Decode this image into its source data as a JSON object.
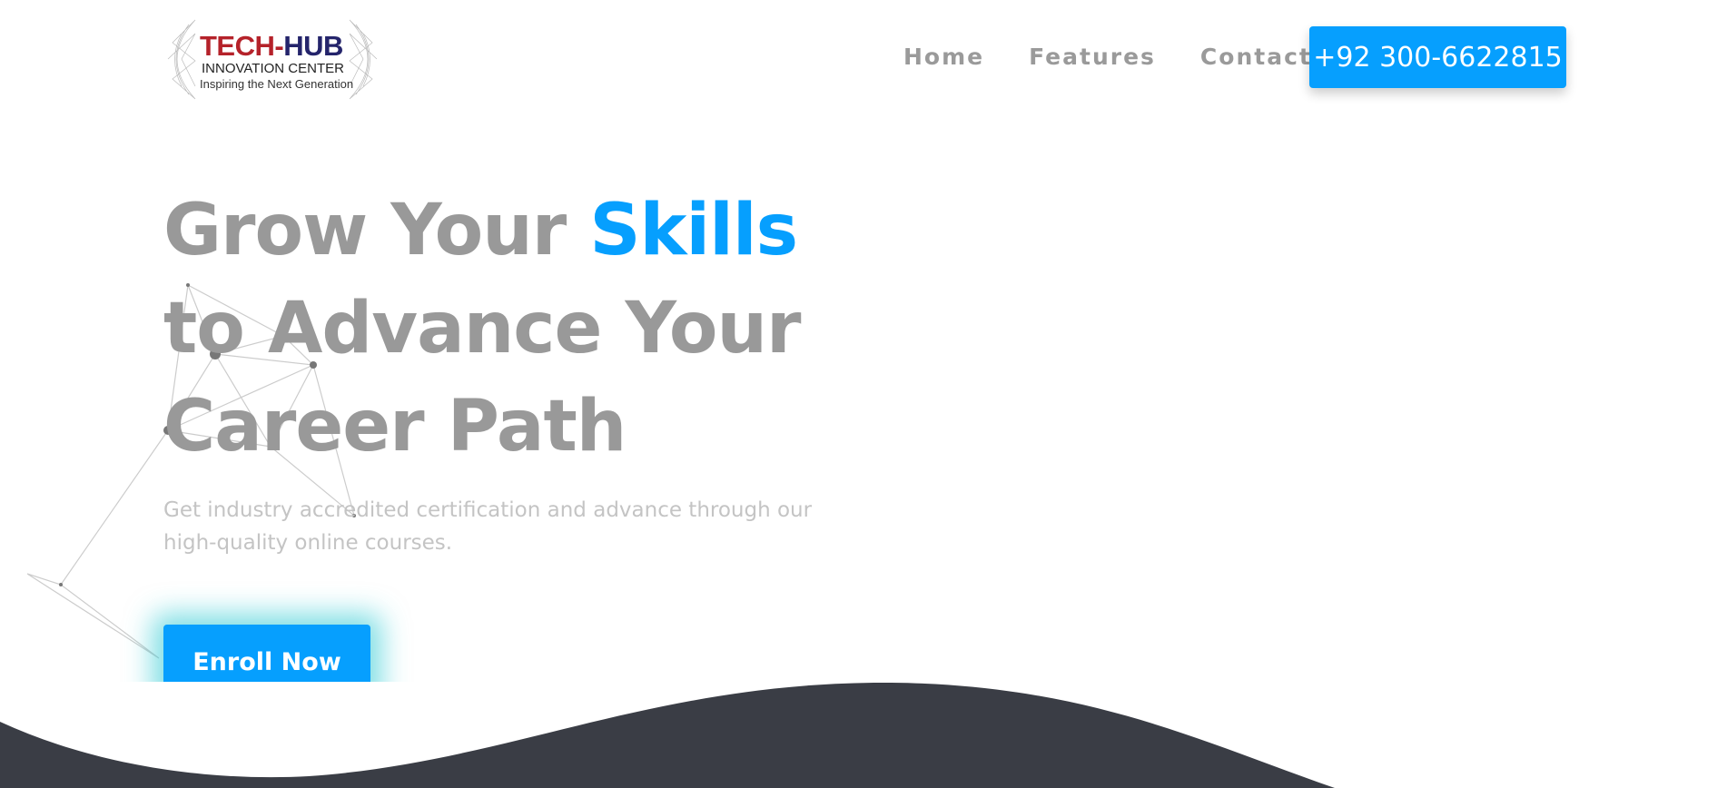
{
  "logo": {
    "brand_part1": "TECH-",
    "brand_part2": "HUB",
    "subtitle": "INNOVATION CENTER",
    "tagline": "Inspiring the Next Generation"
  },
  "nav": {
    "items": [
      {
        "label": "Home"
      },
      {
        "label": "Features"
      },
      {
        "label": "Contact"
      }
    ],
    "phone": "+92 300-6622815"
  },
  "hero": {
    "title_before": "Grow Your ",
    "title_highlight": "Skills",
    "title_after": " to Advance Your Career Path",
    "subtitle": "Get industry accredited certification and advance through our high-quality online courses.",
    "cta": "Enroll Now"
  },
  "colors": {
    "accent": "#069ffe",
    "dark": "#3a3d45",
    "text": "#999999"
  }
}
